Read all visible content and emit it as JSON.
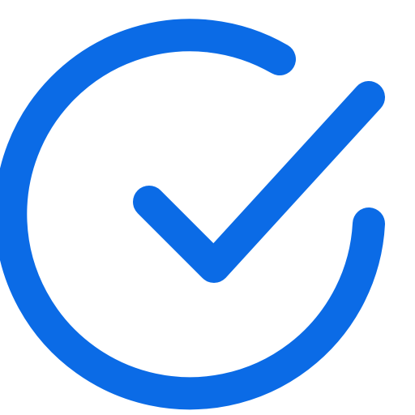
{
  "icon": {
    "name": "check-circle-icon",
    "color": "#0B6BE6",
    "background": "#FFFFFF"
  }
}
